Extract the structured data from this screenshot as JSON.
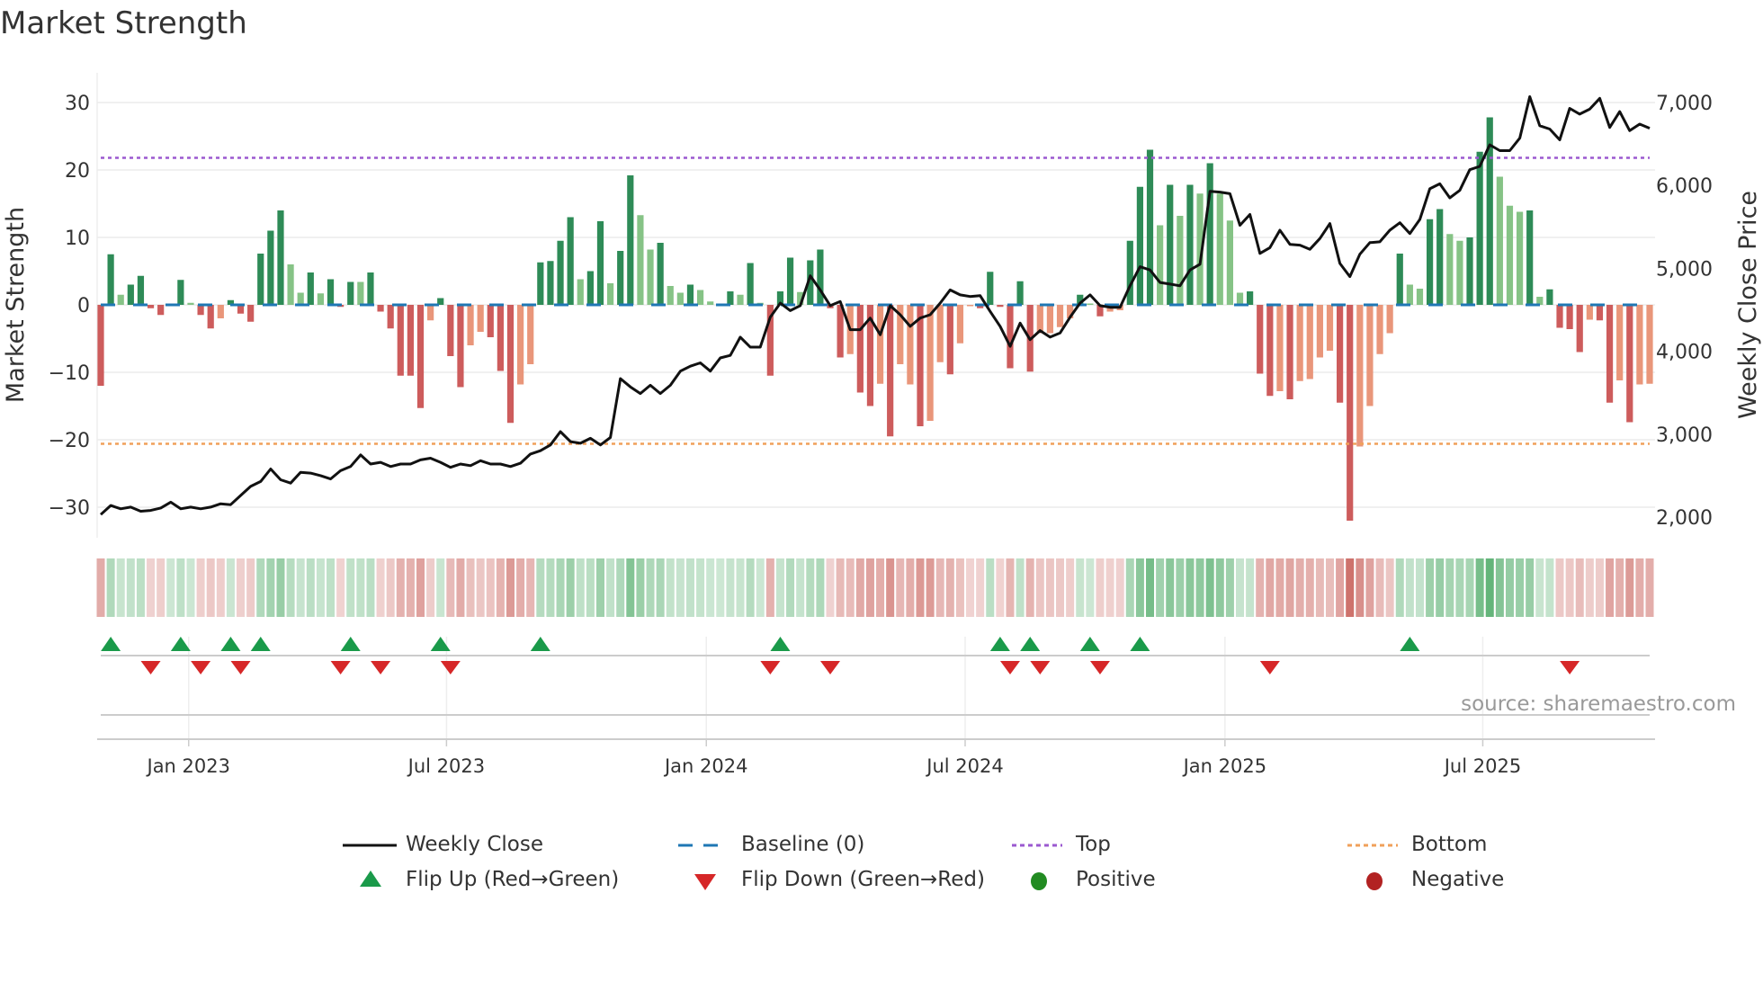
{
  "chart_data": {
    "type": "bar",
    "title": "Market Strength",
    "ylabel": "Market Strength",
    "y2label": "Weekly Close Price",
    "ylim": [
      -34,
      34
    ],
    "y2lim": [
      1600,
      7500
    ],
    "yticks": [
      30,
      20,
      10,
      0,
      -10,
      -20,
      -30
    ],
    "yticklabels": [
      "30",
      "20",
      "10",
      "0",
      "−10",
      "−20",
      "−30"
    ],
    "y2ticks": [
      7000,
      6000,
      5000,
      4000,
      3000,
      2000
    ],
    "y2ticklabels": [
      "7,000",
      "6,000",
      "5,000",
      "4,000",
      "3,000",
      "2,000"
    ],
    "xticks": [
      {
        "week_index": 8.8,
        "label": "Jan 2023"
      },
      {
        "week_index": 34.6,
        "label": "Jul 2023"
      },
      {
        "week_index": 60.6,
        "label": "Jan 2024"
      },
      {
        "week_index": 86.5,
        "label": "Jul 2024"
      },
      {
        "week_index": 112.5,
        "label": "Jan 2025"
      },
      {
        "week_index": 138.3,
        "label": "Jul 2025"
      }
    ],
    "top_level": 21.8,
    "bottom_level": -20.6,
    "baseline": 0,
    "strength": [
      -12,
      7.5,
      1.5,
      3,
      4.3,
      -0.5,
      -1.5,
      0.2,
      3.7,
      0.3,
      -1.5,
      -3.5,
      -2,
      0.7,
      -1.3,
      -2.5,
      7.6,
      11,
      14,
      6,
      1.8,
      4.8,
      1.7,
      3.8,
      -0.3,
      3.4,
      3.4,
      4.8,
      -1,
      -3.5,
      -10.5,
      -10.5,
      -15.3,
      -2.3,
      1,
      -7.6,
      -12.2,
      -6,
      -4,
      -4.8,
      -9.8,
      -17.5,
      -11.8,
      -8.8,
      6.3,
      6.5,
      9.5,
      13,
      3.8,
      5,
      12.4,
      3.2,
      8,
      19.2,
      13.3,
      8.2,
      9.2,
      2.8,
      1.8,
      3,
      2.2,
      0.5,
      0,
      2,
      1.5,
      6.2,
      0.3,
      -10.5,
      2,
      7,
      1.9,
      6.6,
      8.2,
      -0.5,
      -7.8,
      -7.3,
      -13,
      -15,
      -11.7,
      -19.5,
      -8.8,
      -11.8,
      -18,
      -17.2,
      -8.5,
      -10.3,
      -5.7,
      -0.2,
      -0.5,
      4.9,
      -0.3,
      -9.4,
      3.5,
      -9.9,
      -4.2,
      -4.2,
      -3.3,
      -2,
      1.5,
      0.2,
      -1.7,
      -1,
      -0.8,
      9.5,
      17.5,
      23,
      11.8,
      17.8,
      13.2,
      17.8,
      16.5,
      21,
      16.5,
      12.5,
      1.8,
      2,
      -10.2,
      -13.5,
      -12.8,
      -14,
      -11.3,
      -11,
      -7.8,
      -6.8,
      -14.5,
      -32,
      -21,
      -15,
      -7.3,
      -4.2,
      7.6,
      3,
      2.4,
      12.7,
      14.2,
      10.5,
      9.5,
      10,
      22.7,
      27.8,
      19,
      14.7,
      13.8,
      14,
      1.2,
      2.3,
      -3.4,
      -3.6,
      -7,
      -2.2,
      -2.3,
      -14.5,
      -11.2,
      -17.4,
      -11.8,
      -11.7
    ],
    "strength_shade": "RGgGGRRgGgRRrGRRGGGggGgGRGgGRRRRRrGRRrrRRRrrGGGGgGGgGGggGggGgggGgGgRGGgGGRRrRRrRrrRrrRrrRGRRGRrrrrGgRrrGGGgGgGgGgggGRRrRrrrrRRrrrrGggGGggGGGgggGgGRRRrRRrRrr",
    "weekly_close": [
      2030,
      2140,
      2100,
      2120,
      2070,
      2080,
      2110,
      2180,
      2100,
      2120,
      2100,
      2120,
      2160,
      2150,
      2260,
      2370,
      2430,
      2580,
      2450,
      2410,
      2540,
      2530,
      2500,
      2460,
      2560,
      2610,
      2750,
      2640,
      2660,
      2610,
      2640,
      2640,
      2690,
      2710,
      2660,
      2600,
      2640,
      2620,
      2680,
      2640,
      2640,
      2610,
      2650,
      2760,
      2800,
      2870,
      3030,
      2910,
      2890,
      2950,
      2870,
      2960,
      3670,
      3570,
      3490,
      3590,
      3490,
      3590,
      3760,
      3820,
      3860,
      3760,
      3920,
      3950,
      4170,
      4050,
      4050,
      4410,
      4580,
      4490,
      4550,
      4910,
      4740,
      4550,
      4600,
      4260,
      4260,
      4400,
      4200,
      4550,
      4440,
      4300,
      4400,
      4440,
      4580,
      4740,
      4680,
      4660,
      4670,
      4480,
      4300,
      4060,
      4340,
      4140,
      4250,
      4170,
      4220,
      4410,
      4580,
      4680,
      4550,
      4530,
      4530,
      4790,
      5020,
      4980,
      4830,
      4810,
      4790,
      4980,
      5050,
      5930,
      5920,
      5900,
      5520,
      5650,
      5180,
      5250,
      5460,
      5290,
      5280,
      5230,
      5360,
      5540,
      5060,
      4900,
      5170,
      5310,
      5320,
      5460,
      5550,
      5420,
      5590,
      5960,
      6020,
      5850,
      5940,
      6190,
      6230,
      6490,
      6420,
      6420,
      6570,
      7070,
      6720,
      6680,
      6550,
      6930,
      6860,
      6920,
      7050,
      6700,
      6890,
      6660,
      6740,
      6690
    ],
    "flip_up_weeks": [
      1,
      8,
      13,
      16,
      25,
      34,
      44,
      68,
      90,
      93,
      99,
      104,
      131
    ],
    "flip_down_weeks": [
      5,
      10,
      14,
      24,
      28,
      35,
      67,
      73,
      91,
      94,
      100,
      117,
      147
    ],
    "legend": {
      "weekly_close": "Weekly Close",
      "baseline": "Baseline (0)",
      "top": "Top",
      "bottom": "Bottom",
      "flip_up": "Flip Up (Red→Green)",
      "flip_down": "Flip Down (Green→Red)",
      "positive": "Positive",
      "negative": "Negative"
    },
    "legend_placement": "bottom",
    "source": "source: sharemaestro.com"
  },
  "colors": {
    "strong_green": "#2e8b57",
    "weak_green": "#86c386",
    "strong_red": "#cd5c5c",
    "weak_red": "#e9967a",
    "line": "#111111",
    "baseline": "#1f77b4",
    "top": "#9b59d0",
    "bottom": "#f0a05a",
    "flip_up": "#1a9a4a",
    "flip_down": "#d62728",
    "positive": "#228b22",
    "negative": "#b22222"
  }
}
